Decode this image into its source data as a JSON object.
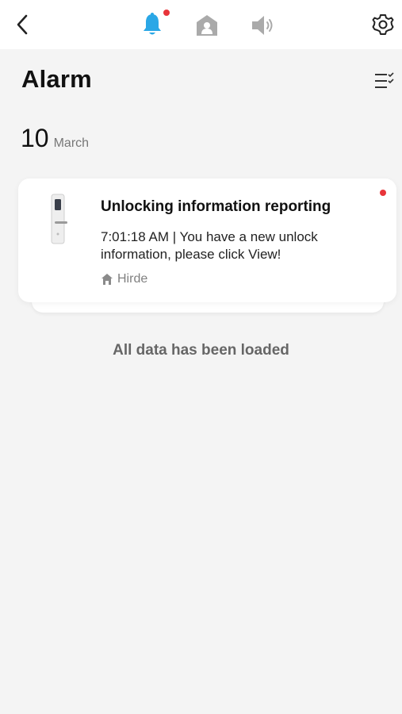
{
  "header": {
    "icons": {
      "back": "chevron-left-icon",
      "notifications": "bell-icon",
      "home": "home-icon",
      "sound": "speaker-icon",
      "settings": "gear-icon"
    }
  },
  "page": {
    "title": "Alarm",
    "filter_icon": "list-check-icon"
  },
  "date_group": {
    "day": "10",
    "month": "March"
  },
  "alarm_card": {
    "title": "Unlocking information reporting",
    "message": "7:01:18 AM | You have a new unlock information, please click View!",
    "location": "Hirde",
    "unread": true
  },
  "footer": {
    "status": "All data has been loaded"
  },
  "colors": {
    "accent_blue": "#2aa7e6",
    "unread_red": "#e8343a",
    "icon_grey": "#aaaaaa",
    "background": "#f4f4f4"
  }
}
